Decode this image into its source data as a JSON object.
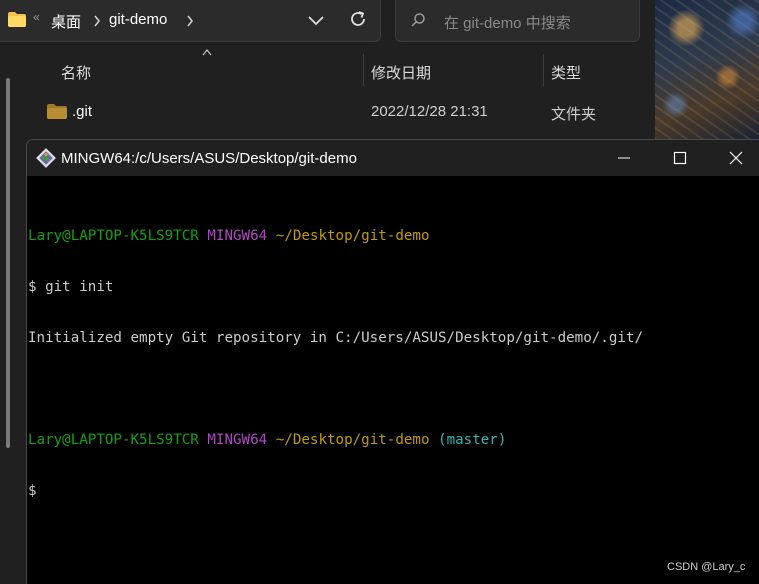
{
  "explorer": {
    "breadcrumb": [
      "桌面",
      "git-demo"
    ],
    "breadcrumb_more": "«",
    "search_placeholder": "在 git-demo 中搜索",
    "columns": [
      "名称",
      "修改日期",
      "类型"
    ],
    "files": [
      {
        "name": ".git",
        "modified": "2022/12/28 21:31",
        "type": "文件夹",
        "icon": "folder-icon"
      }
    ]
  },
  "terminal": {
    "title": "MINGW64:/c/Users/ASUS/Desktop/git-demo",
    "lines": {
      "prompt1_user": "Lary@LAPTOP-K5LS9TCR",
      "prompt1_env": "MINGW64",
      "prompt1_path": "~/Desktop/git-demo",
      "cmd1": "$ git init",
      "output1": "Initialized empty Git repository in C:/Users/ASUS/Desktop/git-demo/.git/",
      "prompt2_user": "Lary@LAPTOP-K5LS9TCR",
      "prompt2_env": "MINGW64",
      "prompt2_path": "~/Desktop/git-demo",
      "prompt2_branch": "(master)",
      "cmd2": "$"
    },
    "controls": {
      "minimize": "minimize-icon",
      "maximize": "maximize-icon",
      "close": "close-icon"
    }
  },
  "watermark": "CSDN @Lary_c",
  "colors": {
    "prompt_user": "#13a10e",
    "prompt_env": "#b148c6",
    "prompt_path": "#c19c00",
    "branch": "#2fb5b5",
    "text": "#cccccc"
  }
}
